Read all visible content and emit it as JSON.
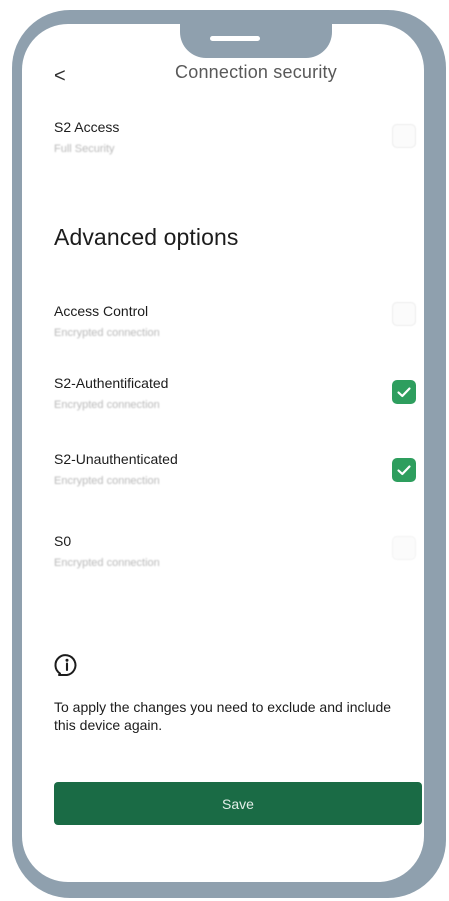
{
  "header": {
    "back_glyph": "<",
    "title": "Connection security"
  },
  "top_option": {
    "label": "S2 Access",
    "sub": "Full Security",
    "checked": false
  },
  "advanced": {
    "title": "Advanced options",
    "items": [
      {
        "label": "Access Control",
        "sub": "Encrypted connection",
        "checked": false
      },
      {
        "label": "S2-Authentificated",
        "sub": "Encrypted connection",
        "checked": true
      },
      {
        "label": "S2-Unauthenticated",
        "sub": "Encrypted connection",
        "checked": true
      },
      {
        "label": "S0",
        "sub": "Encrypted connection",
        "checked": false
      }
    ]
  },
  "info": {
    "icon": "info-icon",
    "text": "To apply the changes you need to exclude and include this device again."
  },
  "save_label": "Save",
  "colors": {
    "frame": "#8fa0ae",
    "accent_green": "#2e9e5e",
    "button_green": "#1a6b45"
  }
}
